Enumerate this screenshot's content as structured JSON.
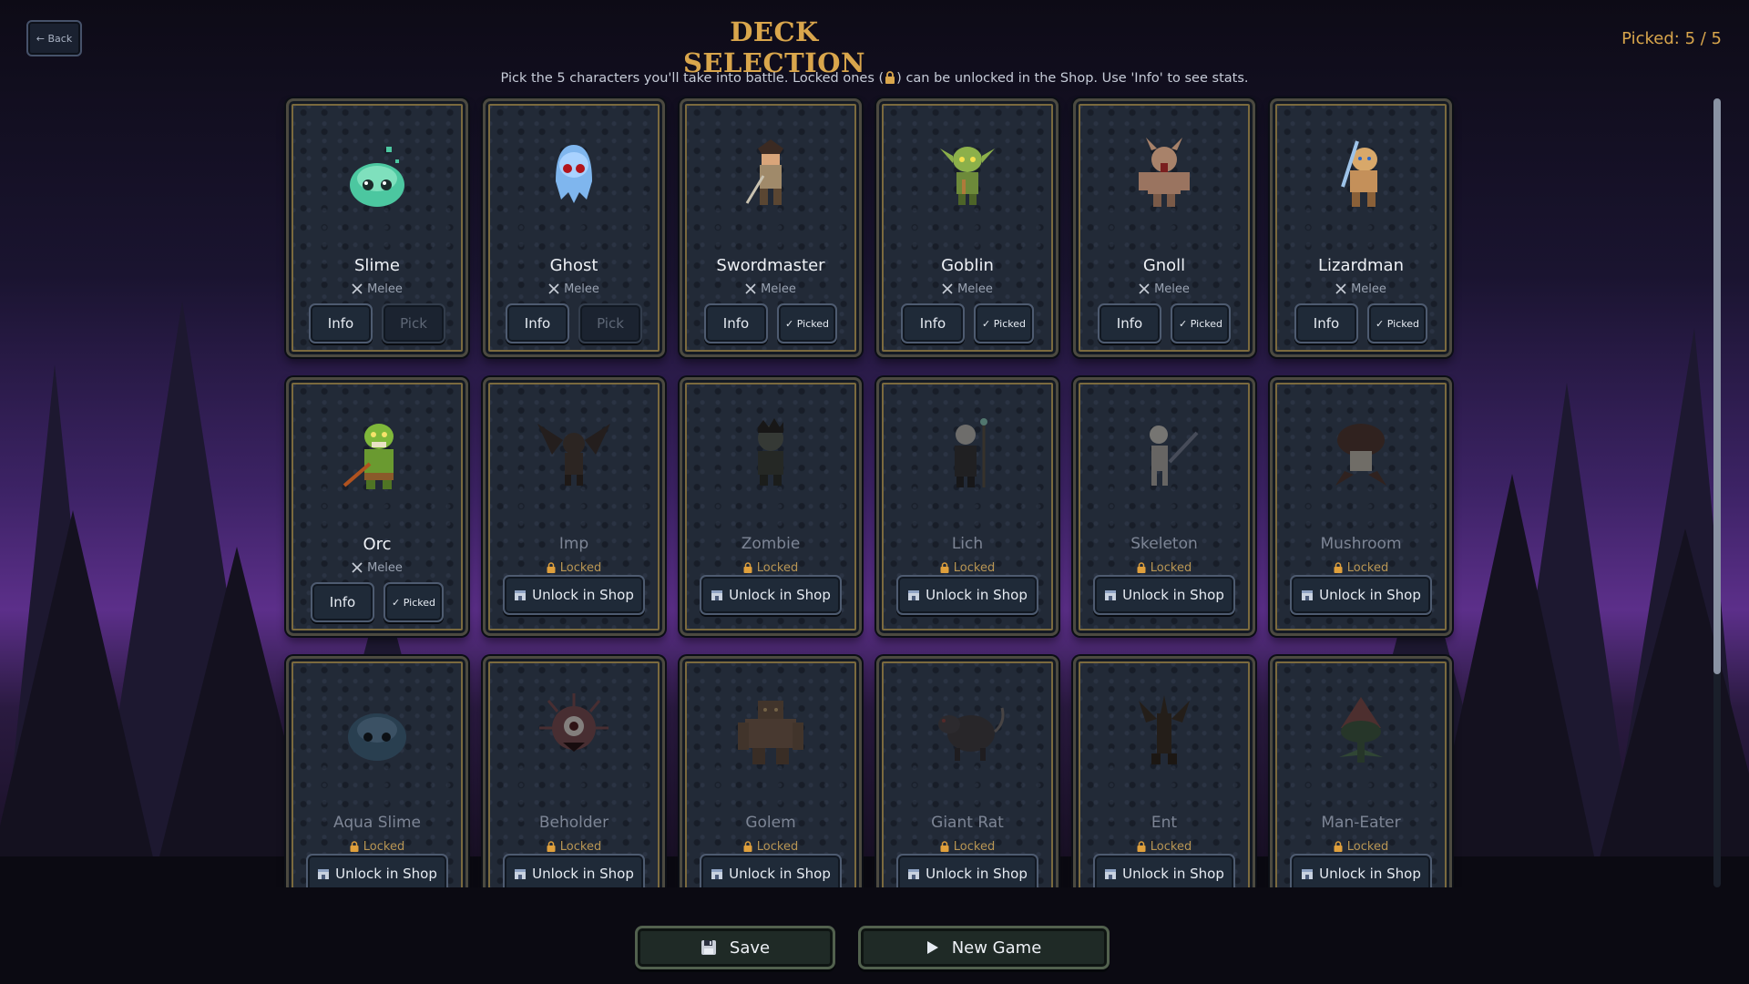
{
  "header": {
    "back_label": "← Back",
    "title": "DECK SELECTION",
    "picked_text": "Picked: 5 / 5",
    "subtitle_before": "Pick the 5 characters you'll take into battle. Locked ones (",
    "subtitle_after": ") can be unlocked in the Shop. Use 'Info' to see stats."
  },
  "labels": {
    "info": "Info",
    "pick": "Pick",
    "picked": "✓ Picked",
    "unlock": "Unlock in Shop",
    "melee": "Melee",
    "locked": "Locked"
  },
  "cards": [
    {
      "name": "Slime",
      "state": "available",
      "icon": "slime"
    },
    {
      "name": "Ghost",
      "state": "available",
      "icon": "ghost"
    },
    {
      "name": "Swordmaster",
      "state": "picked",
      "icon": "swordmaster"
    },
    {
      "name": "Goblin",
      "state": "picked",
      "icon": "goblin"
    },
    {
      "name": "Gnoll",
      "state": "picked",
      "icon": "gnoll"
    },
    {
      "name": "Lizardman",
      "state": "picked",
      "icon": "lizardman"
    },
    {
      "name": "Orc",
      "state": "picked",
      "icon": "orc"
    },
    {
      "name": "Imp",
      "state": "locked",
      "icon": "imp"
    },
    {
      "name": "Zombie",
      "state": "locked",
      "icon": "zombie"
    },
    {
      "name": "Lich",
      "state": "locked",
      "icon": "lich"
    },
    {
      "name": "Skeleton",
      "state": "locked",
      "icon": "skeleton"
    },
    {
      "name": "Mushroom",
      "state": "locked",
      "icon": "mushroom"
    },
    {
      "name": "Aqua Slime",
      "state": "locked",
      "icon": "aqua-slime"
    },
    {
      "name": "Beholder",
      "state": "locked",
      "icon": "beholder"
    },
    {
      "name": "Golem",
      "state": "locked",
      "icon": "golem"
    },
    {
      "name": "Giant Rat",
      "state": "locked",
      "icon": "giant-rat"
    },
    {
      "name": "Ent",
      "state": "locked",
      "icon": "ent"
    },
    {
      "name": "Man-Eater",
      "state": "locked",
      "icon": "man-eater"
    }
  ],
  "footer": {
    "save_label": "Save",
    "new_game_label": "New Game"
  },
  "colors": {
    "accent_gold": "#d9a64c",
    "sky_purple": "#5a2f86",
    "card_bg": "#222a37"
  }
}
